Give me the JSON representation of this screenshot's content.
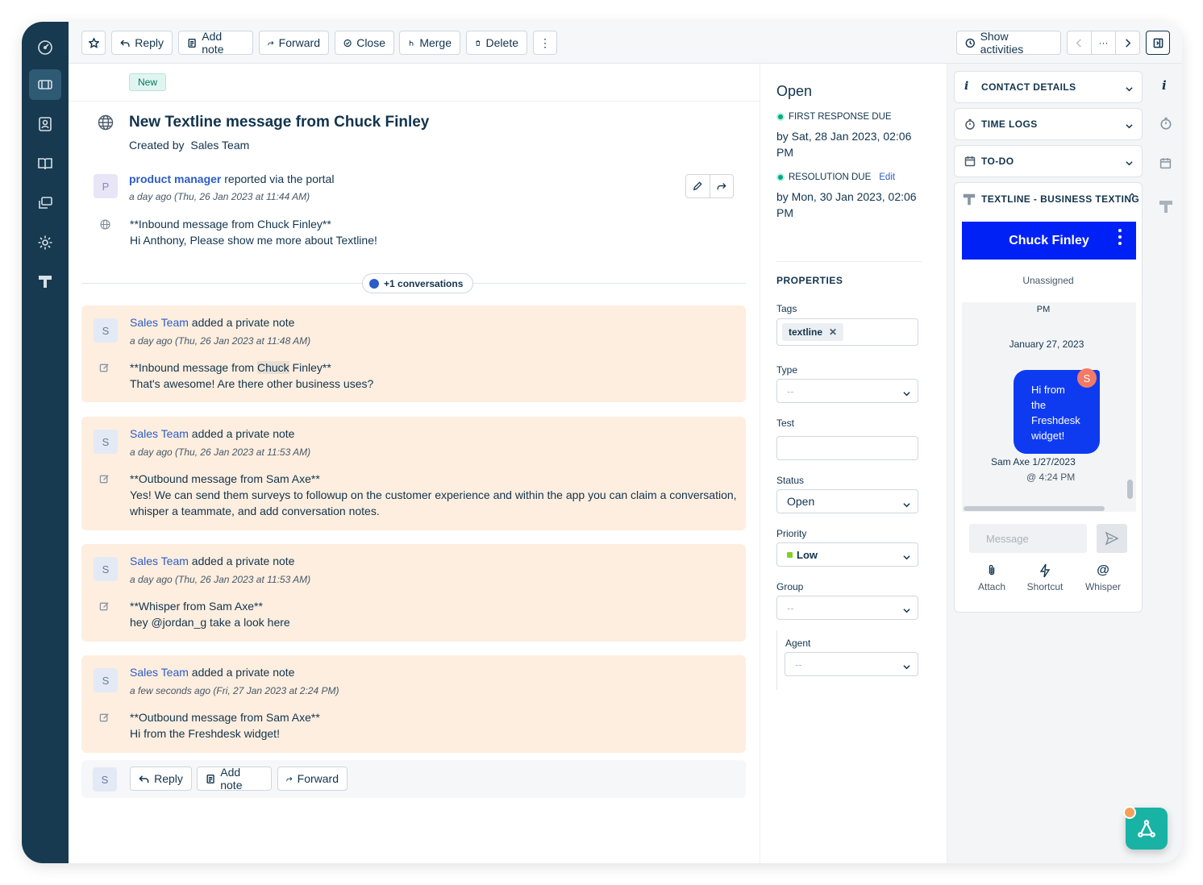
{
  "toolbar": {
    "reply": "Reply",
    "add_note": "Add note",
    "forward": "Forward",
    "close": "Close",
    "merge": "Merge",
    "delete": "Delete",
    "more": "⋮",
    "show_activities": "Show activities",
    "pager_more": "···"
  },
  "ticket": {
    "status_badge": "New",
    "title": "New Textline message from Chuck Finley",
    "created_by_label": "Created by",
    "created_by": "Sales Team",
    "requester_initial": "P",
    "requester": "product manager",
    "reported_text": "reported via the portal",
    "reported_time": "a day ago (Thu, 26 Jan 2023 at 11:44 AM)",
    "body_line1": "**Inbound message from Chuck Finley**",
    "body_line2": "Hi Anthony, Please show me more about Textline!",
    "conversations": "+1 conversations"
  },
  "notes": [
    {
      "initial": "S",
      "author": "Sales Team",
      "action": "added a private note",
      "time": "a day ago (Thu, 26 Jan 2023 at 11:48 AM)",
      "line1_pre": "**Inbound message from ",
      "line1_hl": "Chuck",
      "line1_post": " Finley**",
      "line2": "That's awesome! Are there other business uses?"
    },
    {
      "initial": "S",
      "author": "Sales Team",
      "action": "added a private note",
      "time": "a day ago (Thu, 26 Jan 2023 at 11:53 AM)",
      "line1": "**Outbound message from Sam Axe**",
      "line2": "Yes! We can send them surveys to followup on the customer experience and within the app you can claim a conversation,",
      "line3": "whisper a teammate, and add conversation notes."
    },
    {
      "initial": "S",
      "author": "Sales Team",
      "action": "added a private note",
      "time": "a day ago (Thu, 26 Jan 2023 at 11:53 AM)",
      "line1": "**Whisper from Sam Axe**",
      "line2": "hey @jordan_g take a look here"
    },
    {
      "initial": "S",
      "author": "Sales Team",
      "action": "added a private note",
      "time": "a few seconds ago (Fri, 27 Jan 2023 at 2:24 PM)",
      "line1": "**Outbound message from Sam Axe**",
      "line2": "Hi from the Freshdesk widget!"
    }
  ],
  "reply_bar": {
    "initial": "S",
    "reply": "Reply",
    "add_note": "Add note",
    "forward": "Forward"
  },
  "properties": {
    "status_title": "Open",
    "first_response_label": "FIRST RESPONSE DUE",
    "first_response_line1": "by Sat, 28 Jan 2023, 02:06",
    "first_response_line2": "PM",
    "resolution_label": "RESOLUTION DUE",
    "resolution_edit": "Edit",
    "resolution_line1": "by Mon, 30 Jan 2023, 02:06",
    "resolution_line2": "PM",
    "section": "PROPERTIES",
    "tags_label": "Tags",
    "tag": "textline",
    "type_label": "Type",
    "type_value": "--",
    "test_label": "Test",
    "status_label": "Status",
    "status_value": "Open",
    "priority_label": "Priority",
    "priority_value": "Low",
    "group_label": "Group",
    "group_value": "--",
    "agent_label": "Agent",
    "agent_value": "--"
  },
  "apps": {
    "contact_details": "CONTACT DETAILS",
    "time_logs": "TIME LOGS",
    "todo": "TO-DO",
    "textline": "TEXTLINE - BUSINESS TEXTING",
    "contact_name": "Chuck Finley",
    "assignee": "Unassigned",
    "pm": "PM",
    "date": "January 27, 2023",
    "bubble_text": "Hi from the Freshdesk widget!",
    "bubble_initial": "S",
    "sender": "Sam Axe 1/27/2023",
    "sent_time": "@ 4:24 PM",
    "message_placeholder": "Message",
    "attach": "Attach",
    "shortcut": "Shortcut",
    "whisper": "Whisper"
  },
  "colors": {
    "sidebar": "#173a50",
    "accent_blue": "#0021f5",
    "note_bg": "#fdeedf",
    "link": "#2c5cc5",
    "sla_green": "#00a886",
    "teal_fab": "#18b3a5"
  }
}
